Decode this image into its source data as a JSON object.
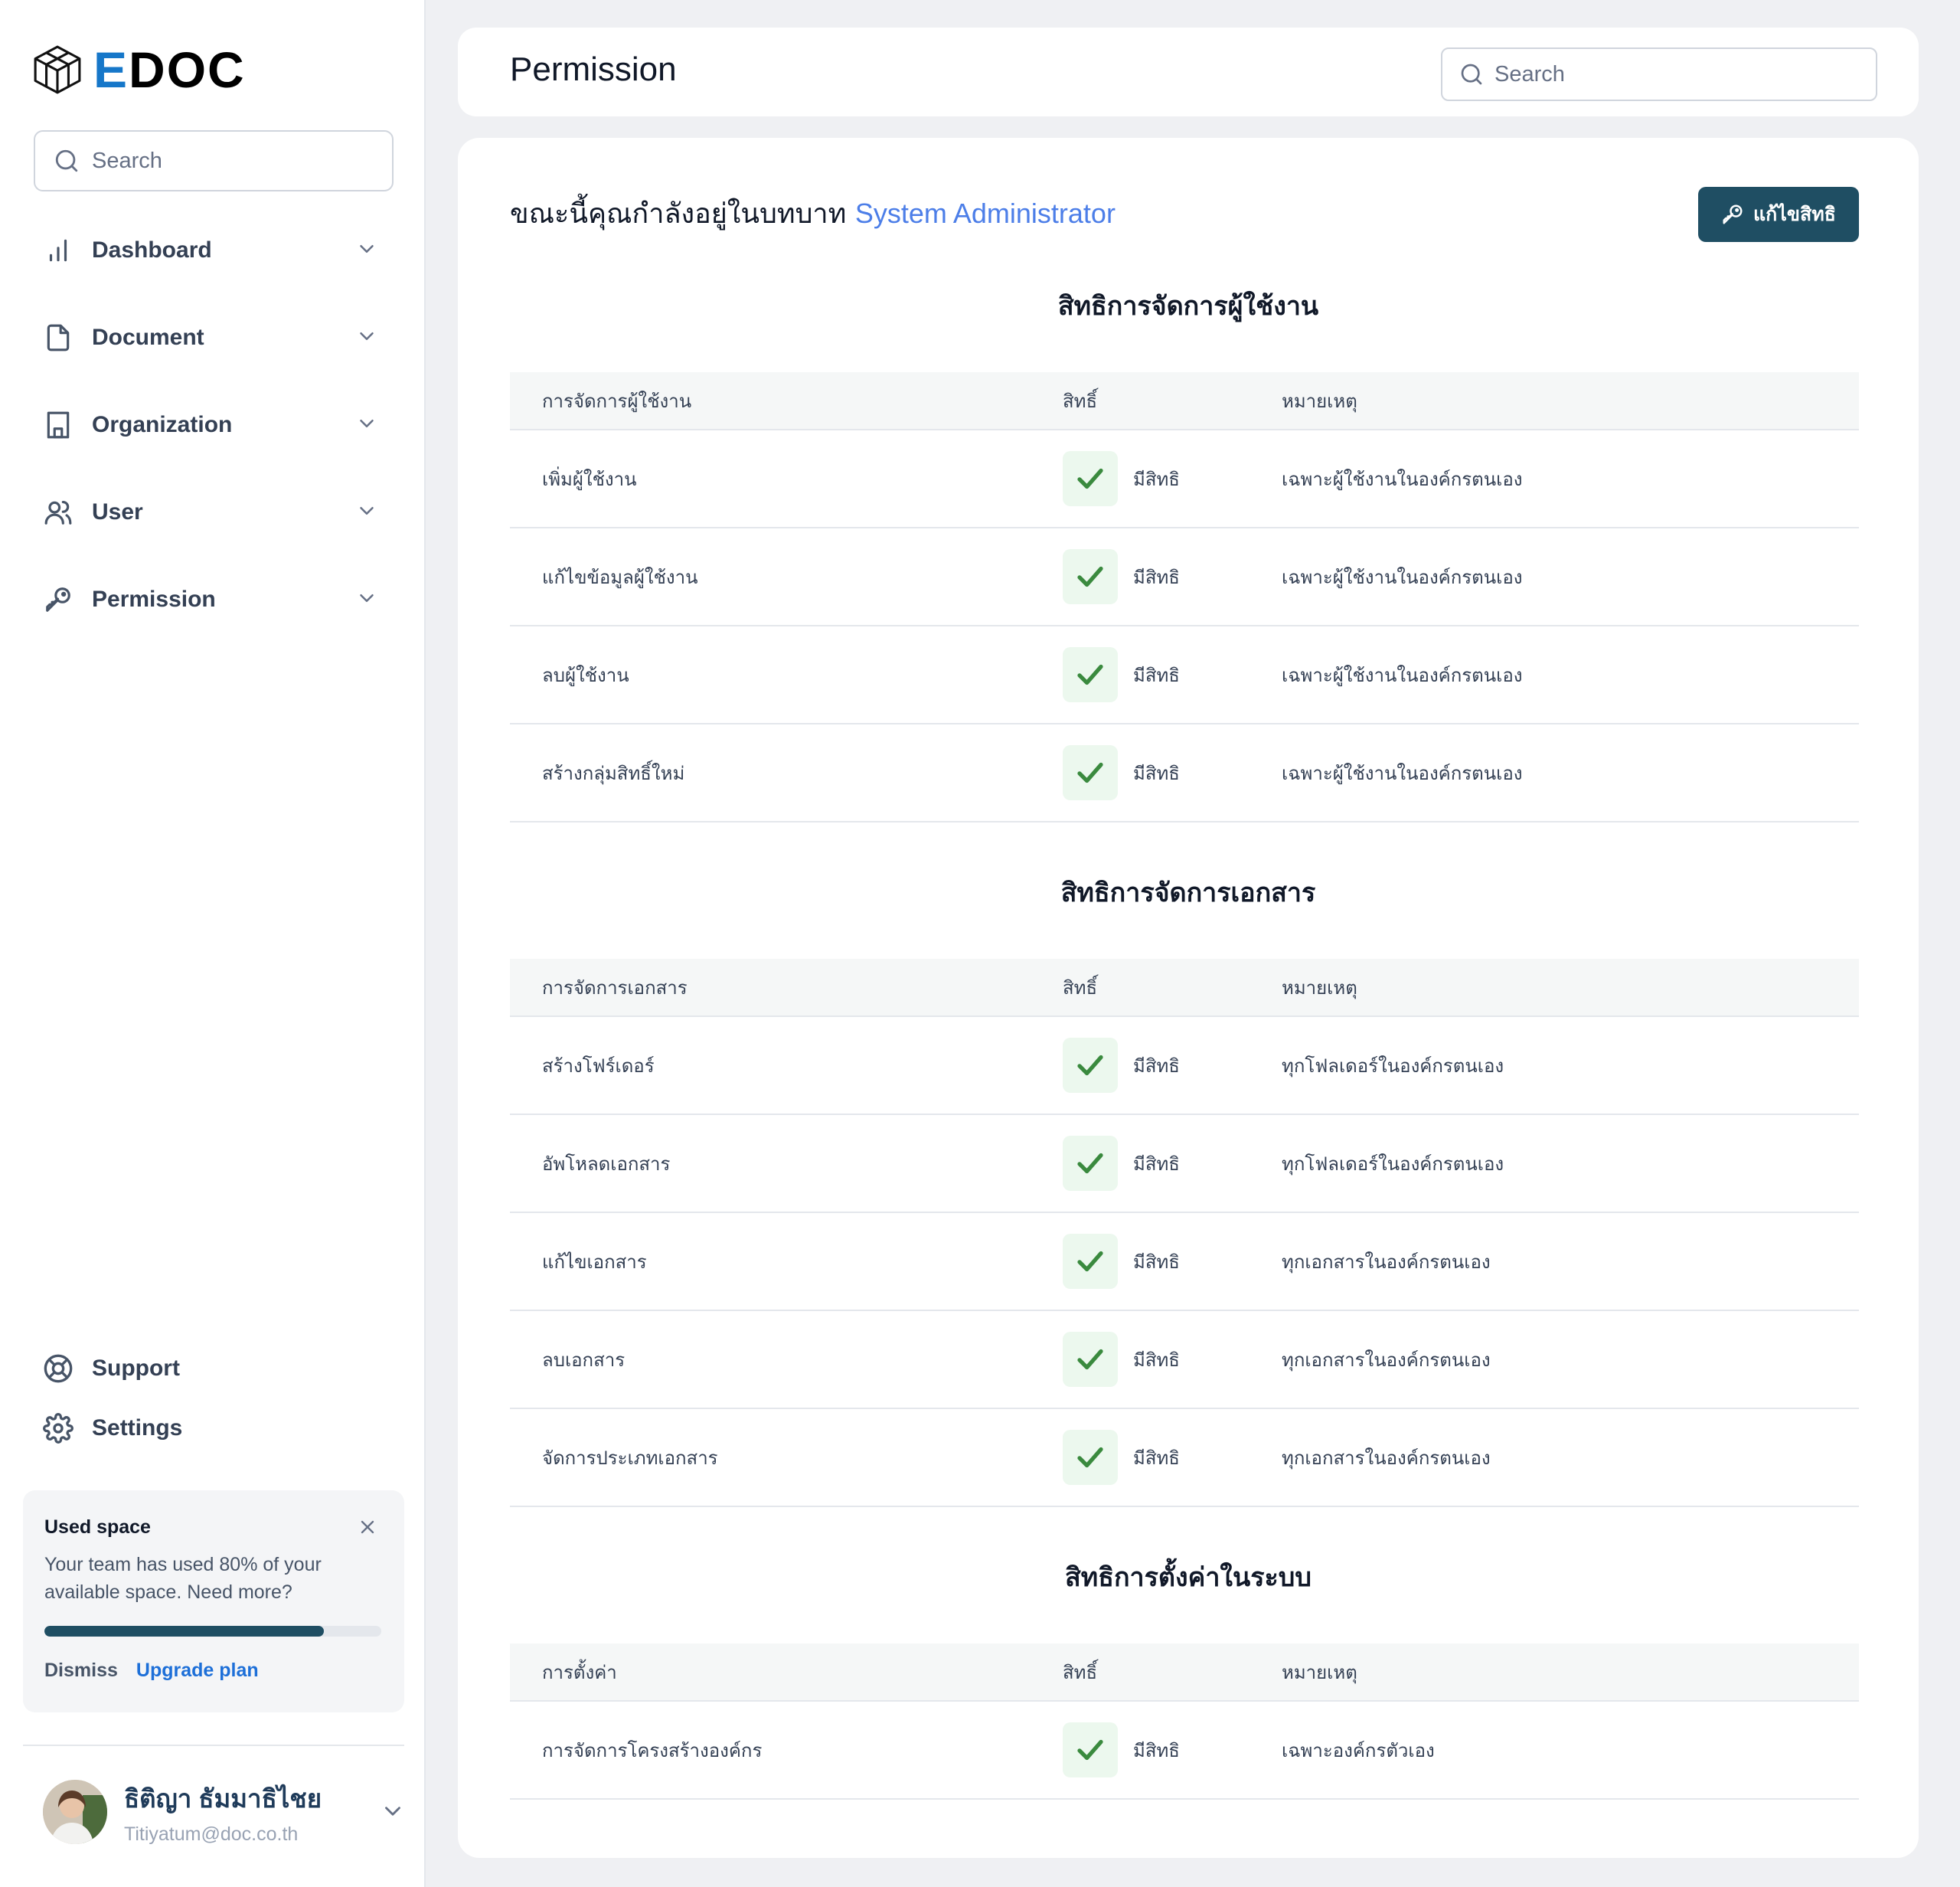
{
  "app": {
    "logo_text_e": "E",
    "logo_text_rest": "DOC"
  },
  "sidebar": {
    "search_placeholder": "Search",
    "items": [
      {
        "label": "Dashboard",
        "icon": "bar-chart-icon"
      },
      {
        "label": "Document",
        "icon": "file-icon"
      },
      {
        "label": "Organization",
        "icon": "building-icon"
      },
      {
        "label": "User",
        "icon": "users-icon"
      },
      {
        "label": "Permission",
        "icon": "key-icon"
      }
    ],
    "bottom_items": [
      {
        "label": "Support",
        "icon": "life-buoy-icon"
      },
      {
        "label": "Settings",
        "icon": "gear-icon"
      }
    ],
    "usage": {
      "title": "Used space",
      "text": "Your team has used 80% of your available space. Need more?",
      "progress": 0.83,
      "dismiss": "Dismiss",
      "upgrade": "Upgrade plan"
    },
    "profile": {
      "name": "ธิติญา ธัมมาธิไชย",
      "email": "Titiyatum@doc.co.th"
    }
  },
  "header": {
    "title": "Permission",
    "search_placeholder": "Search"
  },
  "content": {
    "role_prefix": "ขณะนี้คุณกำลังอยู่ในบทบาท",
    "role_name": "System Administrator",
    "edit_button": "แก้ไขสิทธิ",
    "sections": [
      {
        "title": "สิทธิการจัดการผู้ใช้งาน",
        "headers": [
          "การจัดการผู้ใช้งาน",
          "สิทธิ์",
          "หมายเหตุ"
        ],
        "rows": [
          {
            "name": "เพิ่มผู้ใช้งาน",
            "right": "มีสิทธิ",
            "note": "เฉพาะผู้ใช้งานในองค์กรตนเอง"
          },
          {
            "name": "แก้ไขข้อมูลผู้ใช้งาน",
            "right": "มีสิทธิ",
            "note": "เฉพาะผู้ใช้งานในองค์กรตนเอง"
          },
          {
            "name": "ลบผู้ใช้งาน",
            "right": "มีสิทธิ",
            "note": "เฉพาะผู้ใช้งานในองค์กรตนเอง"
          },
          {
            "name": "สร้างกลุ่มสิทธิ์ใหม่",
            "right": "มีสิทธิ",
            "note": "เฉพาะผู้ใช้งานในองค์กรตนเอง"
          }
        ]
      },
      {
        "title": "สิทธิการจัดการเอกสาร",
        "headers": [
          "การจัดการเอกสาร",
          "สิทธิ์",
          "หมายเหตุ"
        ],
        "rows": [
          {
            "name": "สร้างโฟร์เดอร์",
            "right": "มีสิทธิ",
            "note": "ทุกโฟลเดอร์ในองค์กรตนเอง"
          },
          {
            "name": "อัพโหลดเอกสาร",
            "right": "มีสิทธิ",
            "note": "ทุกโฟลเดอร์ในองค์กรตนเอง"
          },
          {
            "name": "แก้ไขเอกสาร",
            "right": "มีสิทธิ",
            "note": "ทุกเอกสารในองค์กรตนเอง"
          },
          {
            "name": "ลบเอกสาร",
            "right": "มีสิทธิ",
            "note": "ทุกเอกสารในองค์กรตนเอง"
          },
          {
            "name": "จัดการประเภทเอกสาร",
            "right": "มีสิทธิ",
            "note": "ทุกเอกสารในองค์กรตนเอง"
          }
        ]
      },
      {
        "title": "สิทธิการตั้งค่าในระบบ",
        "headers": [
          "การตั้งค่า",
          "สิทธิ์",
          "หมายเหตุ"
        ],
        "rows": [
          {
            "name": "การจัดการโครงสร้างองค์กร",
            "right": "มีสิทธิ",
            "note": "เฉพาะองค์กรตัวเอง"
          }
        ]
      }
    ]
  },
  "colors": {
    "accent": "#1f4e63",
    "role": "#4c7ee8",
    "check": "#3a8a3e",
    "check_bg": "#ecf8ee"
  }
}
